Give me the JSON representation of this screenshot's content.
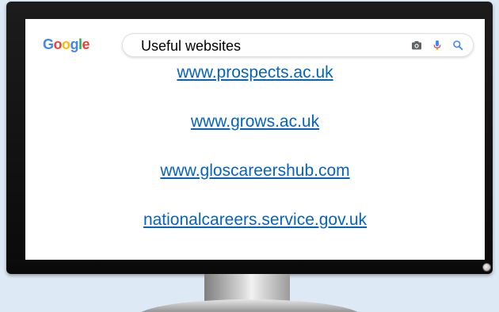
{
  "search": {
    "logo_letters": [
      "G",
      "o",
      "o",
      "g",
      "l",
      "e"
    ],
    "query": "Useful websites",
    "icons": [
      "camera-icon",
      "microphone-icon",
      "search-icon"
    ]
  },
  "links": [
    "www.prospects.ac.uk",
    "www.grows.ac.uk",
    "www.gloscareershub.com",
    "nationalcareers.service.gov.uk"
  ],
  "colors": {
    "link": "#0563C1",
    "background": "#dde9f5",
    "bezel": "#111111",
    "logo": [
      "#4285F4",
      "#EA4335",
      "#FBBC05",
      "#4285F4",
      "#34A853",
      "#EA4335"
    ]
  }
}
